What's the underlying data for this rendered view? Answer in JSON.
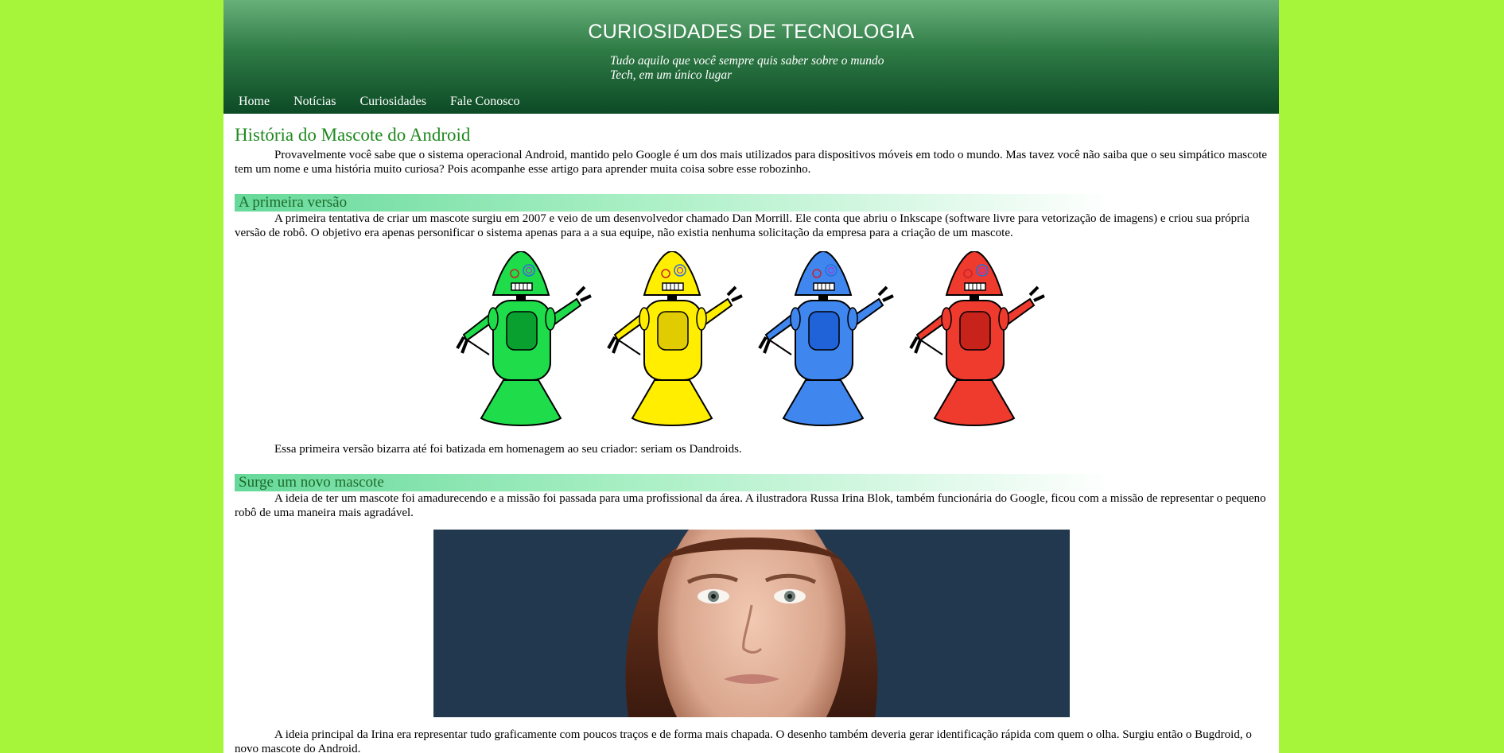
{
  "header": {
    "title": "CURIOSIDADES DE TECNOLOGIA",
    "tagline_line1": "Tudo aquilo que você sempre quis saber sobre o mundo",
    "tagline_line2": "Tech, em um único lugar"
  },
  "nav": {
    "items": [
      {
        "label": "Home"
      },
      {
        "label": "Notícias"
      },
      {
        "label": "Curiosidades"
      },
      {
        "label": "Fale Conosco"
      }
    ]
  },
  "article": {
    "title": "História do Mascote do Android",
    "intro": "Provavelmente você sabe que o sistema operacional Android, mantido pelo Google é um dos mais utilizados para dispositivos móveis em todo o mundo. Mas tavez você não saiba que o seu simpático mascote tem um nome e uma história muito curiosa? Pois acompanhe esse artigo para aprender muita coisa sobre esse robozinho.",
    "sections": [
      {
        "heading": "A primeira versão",
        "text": "A primeira tentativa de criar um mascote surgiu em 2007 e veio de um desenvolvedor chamado Dan Morrill. Ele conta que abriu o Inkscape (software livre para vetorização de imagens) e criou sua própria versão de robô. O objetivo era apenas personificar o sistema apenas para a a sua equipe, não existia nenhuma solicitação da empresa para a criação de um mascote.",
        "caption": "Essa primeira versão bizarra até foi batizada em homenagem ao seu criador: seriam os Dandroids."
      },
      {
        "heading": "Surge um novo mascote",
        "text": "A ideia de ter um mascote foi amadurecendo e a missão foi passada para uma profissional da área. A ilustradora Russa Irina Blok, também funcionária do Google, ficou com a missão de representar o pequeno robô de uma maneira mais agradável.",
        "after": "A ideia principal da Irina era representar tudo graficamente com poucos traços e de forma mais chapada. O desenho também deveria gerar identificação rápida com quem o olha. Surgiu então o Bugdroid, o novo mascote do Android."
      }
    ]
  },
  "colors": {
    "background": "#a6f53b",
    "header_dark": "#0c4a25",
    "title_green": "#1f8a1f",
    "robot_colors": [
      "#1fdc4a",
      "#ffee00",
      "#3f86ef",
      "#ef3a2e"
    ]
  }
}
